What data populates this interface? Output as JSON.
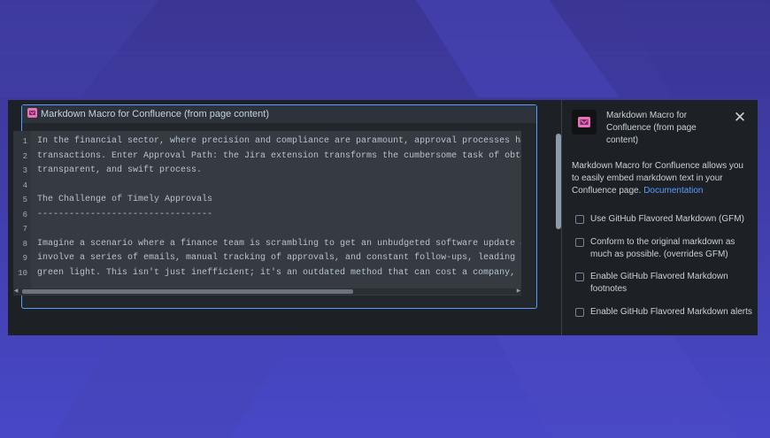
{
  "macro": {
    "title": "Markdown Macro for Confluence (from page content)",
    "lines": [
      {
        "n": "1",
        "text": "In the financial sector, where precision and compliance are paramount, approval processes have"
      },
      {
        "n": "2",
        "text": "transactions. Enter Approval Path: the Jira extension transforms the cumbersome task of obtair"
      },
      {
        "n": "3",
        "text": "transparent, and swift process."
      },
      {
        "n": "4",
        "text": ""
      },
      {
        "n": "5",
        "text": "The Challenge of Timely Approvals"
      },
      {
        "n": "6",
        "text": "---------------------------------"
      },
      {
        "n": "7",
        "text": ""
      },
      {
        "n": "8",
        "text": "Imagine a scenario where a finance team is scrambling to get an unbudgeted software update app"
      },
      {
        "n": "9",
        "text": "involve a series of emails, manual tracking of approvals, and constant follow-ups, leading to"
      },
      {
        "n": "10",
        "text": "green light. This isn't just inefficient; it's an outdated method that can cost a company, not"
      }
    ]
  },
  "panel": {
    "title": "Markdown Macro for Confluence (from page content)",
    "description": "Markdown Macro for Confluence allows you to easily embed markdown text in your Confluence page.",
    "doc_link": "Documentation",
    "options": [
      {
        "label": "Use GitHub Flavored Markdown (GFM)",
        "checked": false
      },
      {
        "label": "Conform to the original markdown as much as possible. (overrides GFM)",
        "checked": false
      },
      {
        "label": "Enable GitHub Flavored Markdown footnotes",
        "checked": false
      },
      {
        "label": "Enable GitHub Flavored Markdown alerts",
        "checked": false
      }
    ]
  },
  "colors": {
    "accent": "#579dff",
    "background": "#3d3aa0",
    "logo": "#e774bb"
  }
}
